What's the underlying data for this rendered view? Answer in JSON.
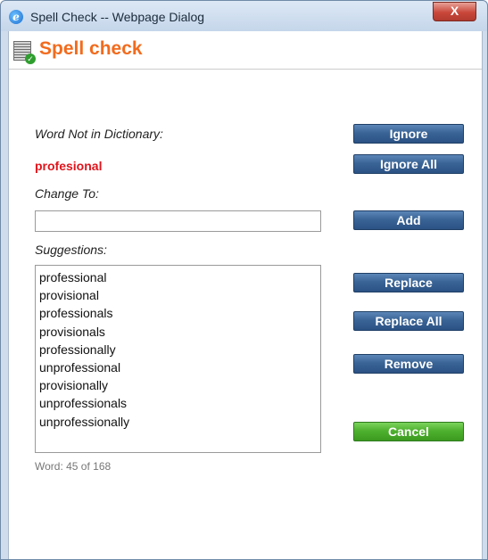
{
  "window": {
    "title": "Spell Check -- Webpage Dialog",
    "close_label": "X"
  },
  "header": {
    "title": "Spell check"
  },
  "labels": {
    "not_in_dictionary": "Word Not in Dictionary:",
    "change_to": "Change To:",
    "suggestions": "Suggestions:"
  },
  "misspelled_word": "profesional",
  "change_to_value": "",
  "suggestions": [
    "professional",
    "provisional",
    "professionals",
    "provisionals",
    "professionally",
    "unprofessional",
    "provisionally",
    "unprofessionals",
    "unprofessionally"
  ],
  "word_count": "Word: 45 of 168",
  "buttons": {
    "ignore": "Ignore",
    "ignore_all": "Ignore All",
    "add": "Add",
    "replace": "Replace",
    "replace_all": "Replace All",
    "remove": "Remove",
    "cancel": "Cancel"
  },
  "colors": {
    "header_title": "#f26b1d",
    "misspelled": "#e0141c",
    "button_blue": "#3a6496",
    "button_green": "#4fb12f"
  }
}
